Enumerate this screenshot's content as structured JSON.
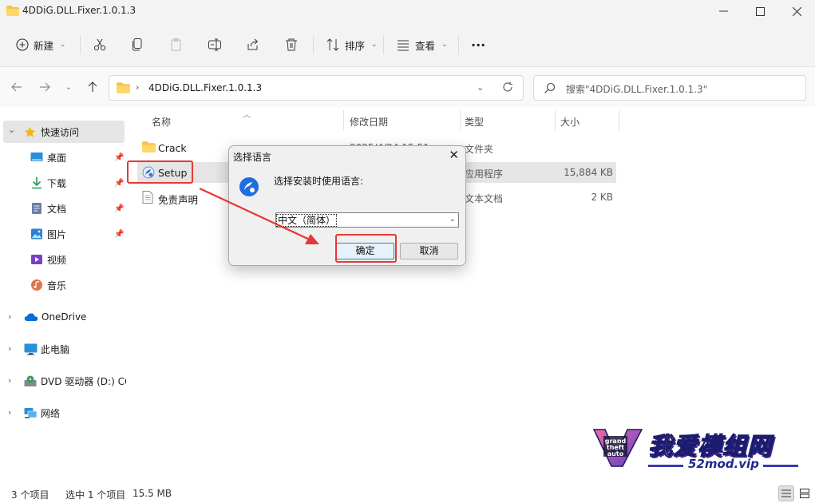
{
  "window": {
    "title": "4DDiG.DLL.Fixer.1.0.1.3"
  },
  "commandbar": {
    "new_label": "新建",
    "sort_label": "排序",
    "view_label": "查看",
    "more_label": "···"
  },
  "navigation": {
    "path_segment": "4DDiG.DLL.Fixer.1.0.1.3",
    "search_placeholder": "搜索\"4DDiG.DLL.Fixer.1.0.1.3\""
  },
  "sidebar": {
    "quick_access": "快速访问",
    "items": [
      {
        "label": "桌面",
        "icon": "desktop-icon"
      },
      {
        "label": "下载",
        "icon": "download-icon"
      },
      {
        "label": "文档",
        "icon": "document-icon"
      },
      {
        "label": "图片",
        "icon": "picture-icon"
      },
      {
        "label": "视频",
        "icon": "video-icon"
      },
      {
        "label": "音乐",
        "icon": "music-icon"
      }
    ],
    "roots": [
      {
        "label": "OneDrive",
        "icon": "cloud-icon"
      },
      {
        "label": "此电脑",
        "icon": "computer-icon"
      },
      {
        "label": "DVD 驱动器 (D:) CC",
        "icon": "dvd-icon"
      },
      {
        "label": "网络",
        "icon": "network-icon"
      }
    ]
  },
  "filelist": {
    "columns": [
      "名称",
      "修改日期",
      "类型",
      "大小"
    ],
    "rows": [
      {
        "name": "Crack",
        "date": "2025/4/24 15:51",
        "type": "文件夹",
        "size": ""
      },
      {
        "name": "Setup",
        "date": "",
        "type": "应用程序",
        "size": "15,884 KB"
      },
      {
        "name": "免责声明",
        "date": "",
        "type": "文本文档",
        "size": "2 KB"
      }
    ]
  },
  "dialog": {
    "title": "选择语言",
    "close": "✕",
    "prompt": "选择安装时使用语言:",
    "selected_language": "中文（简体）",
    "ok_label": "确定",
    "cancel_label": "取消"
  },
  "statusbar": {
    "item_count": "3 个项目",
    "selected": "选中 1 个项目",
    "size": "15.5 MB"
  },
  "watermark": {
    "brand_cn": "我爱模组网",
    "site": "52mod.vip"
  },
  "colors": {
    "highlight": "#e53935",
    "selection": "#e5e5e5",
    "folder": "#f4c44e"
  }
}
